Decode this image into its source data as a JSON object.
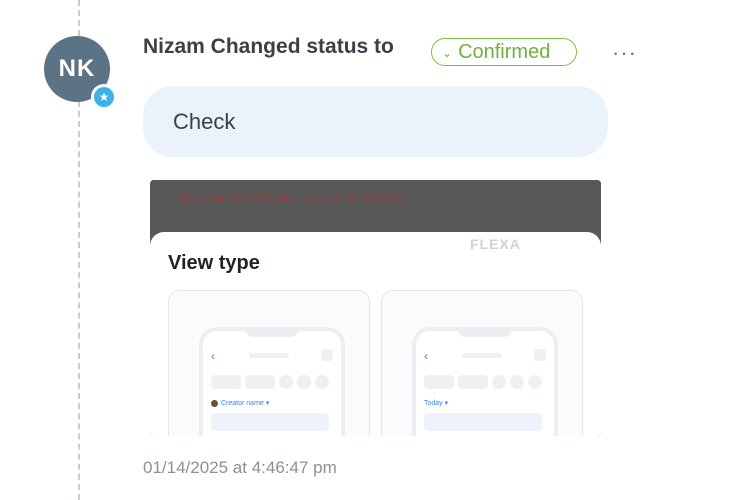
{
  "event": {
    "avatar_initials": "NK",
    "avatar_badge_icon": "star-icon",
    "heading": "Nizam Changed status to",
    "status_label": "Confirmed",
    "status_color": "#6cb33f",
    "more_label": "···",
    "comment": "Check",
    "timestamp": "01/14/2025 at 4:46:47 pm"
  },
  "attachment": {
    "header_text": "Starts Jan 05 10:04 AM - Due Jan 05 11:04 AM",
    "watermark": "FLEXA",
    "view_type_title": "View type",
    "cards": [
      {
        "label": "Creator name ▾"
      },
      {
        "label": "Today ▾"
      }
    ]
  }
}
